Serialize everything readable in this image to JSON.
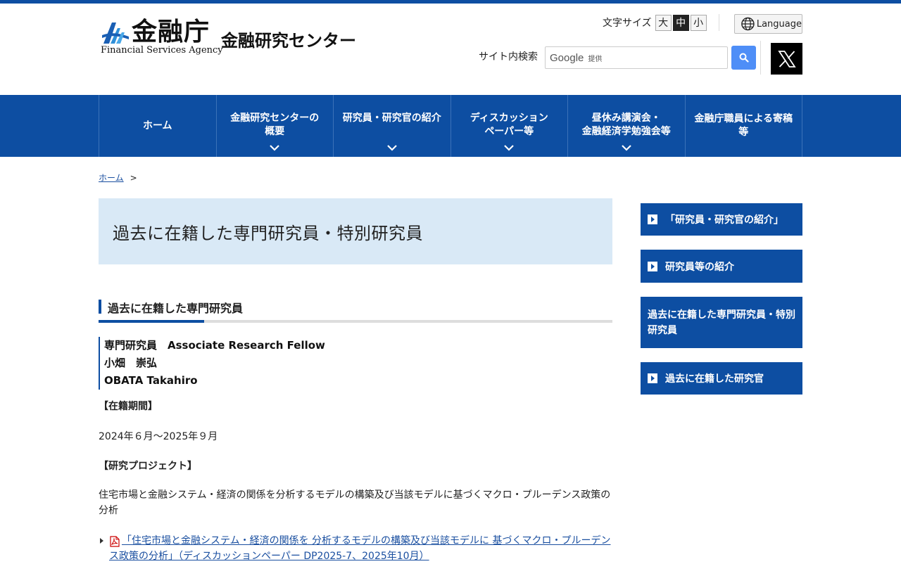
{
  "header": {
    "logo_jp": "金融庁",
    "logo_en": "Financial Services Agency",
    "center_name": "金融研究センター",
    "font_size_label": "文字サイズ",
    "font_sizes": [
      "大",
      "中",
      "小"
    ],
    "font_size_selected": "中",
    "language_label": "Language",
    "search_label": "サイト内検索",
    "search_brand": "Google",
    "search_provided": "提供"
  },
  "nav": {
    "items": [
      {
        "label": "ホーム"
      },
      {
        "label_line1": "金融研究センターの",
        "label_line2": "概要"
      },
      {
        "label": "研究員・研究官の紹介"
      },
      {
        "label_line1": "ディスカッション",
        "label_line2": "ペーパー等"
      },
      {
        "label_line1": "昼休み講演会・",
        "label_line2": "金融経済学勉強会等"
      },
      {
        "label_line1": "金融庁職員による寄稿",
        "label_line2": "等"
      }
    ]
  },
  "breadcrumb": {
    "home": "ホーム",
    "separator": ">"
  },
  "main": {
    "page_title": "過去に在籍した専門研究員・特別研究員",
    "section_title": "過去に在籍した専門研究員",
    "person": {
      "role": "専門研究員　Associate Research Fellow",
      "name_jp": "小畑　崇弘",
      "name_en": "OBATA Takahiro"
    },
    "period_heading": "【在籍期間】",
    "period": "2024年６月～2025年９月",
    "project_heading": "【研究プロジェクト】",
    "project_desc": "住宅市場と金融システム・経済の関係を分析するモデルの構築及び当該モデルに基づくマクロ・プルーデンス政策の分析",
    "doc_link": "「住宅市場と金融システム・経済の関係を 分析するモデルの構築及び当該モデルに 基づくマクロ・プルーデンス政策の分析」（ディスカッションペーパー DP2025-7、2025年10月）"
  },
  "sidebar": {
    "items": [
      {
        "label": "「研究員・研究官の紹介」"
      },
      {
        "label": "研究員等の紹介"
      },
      {
        "label": "過去に在籍した専門研究員・特別研究員"
      },
      {
        "label": "過去に在籍した研究官"
      }
    ]
  },
  "colors": {
    "brand": "#0d4ea2",
    "title_bg": "#d9e9f6",
    "link": "#1a4fa0",
    "search_button": "#4e8ef7"
  }
}
